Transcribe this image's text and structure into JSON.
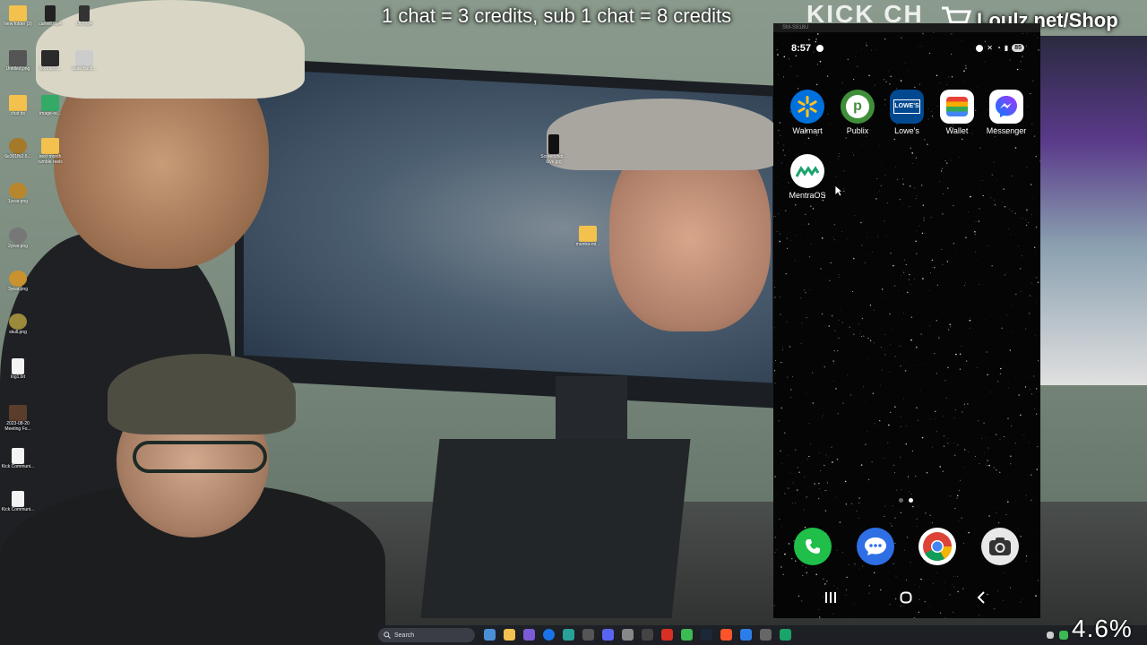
{
  "overlay": {
    "credits_text": "1 chat = 3 credits, sub 1 chat = 8 credits",
    "shop_text": "Loulz.net/Shop",
    "shop_bg_text": "KICK CH",
    "zoom_readout": "4.6%"
  },
  "desktop_icons": [
    {
      "label": "New folder (2)",
      "icon": "folder-icon"
    },
    {
      "label": "camell.mp4",
      "icon": "video-file-icon"
    },
    {
      "label": "cfb.mp4",
      "icon": "video-file-icon"
    },
    {
      "label": "Untitled.png",
      "icon": "image-file-icon"
    },
    {
      "label": "liketrains...",
      "icon": "image-file-icon"
    },
    {
      "label": "waterbuck...",
      "icon": "image-file-icon"
    },
    {
      "label": "chat tts",
      "icon": "folder-icon"
    },
    {
      "label": "image-re...",
      "icon": "image-file-icon"
    },
    {
      "label": "6e301fb2-5...",
      "icon": "image-file-icon"
    },
    {
      "label": "next month rumble reels",
      "icon": "folder-icon"
    },
    {
      "label": "1year.png",
      "icon": "badge-icon"
    },
    {
      "label": "2year.png",
      "icon": "badge-icon"
    },
    {
      "label": "3year.png",
      "icon": "badge-icon"
    },
    {
      "label": "skull.png",
      "icon": "skull-icon"
    },
    {
      "label": "log1.txt",
      "icon": "text-file-icon"
    },
    {
      "label": "2023-08-20 Meeting Fo...",
      "icon": "image-file-icon"
    },
    {
      "label": "Kick Communi...",
      "icon": "text-file-icon"
    },
    {
      "label": "Kick Communi...",
      "icon": "text-file-icon"
    }
  ],
  "monitor_files": [
    {
      "label": "Screenshot... Live.jpg",
      "icon": "image-file-icon"
    },
    {
      "label": "mentra-mi...",
      "icon": "folder-icon"
    }
  ],
  "phone": {
    "window_title": "SM-S918U",
    "status_time": "8:57",
    "battery": "85",
    "apps": [
      {
        "name": "Walmart",
        "icon": "walmart-icon",
        "color": "#0071dc"
      },
      {
        "name": "Publix",
        "icon": "publix-icon",
        "color": "#3f8f3a"
      },
      {
        "name": "Lowe's",
        "icon": "lowes-icon",
        "color": "#004990"
      },
      {
        "name": "Wallet",
        "icon": "wallet-icon",
        "color": "#ffffff"
      },
      {
        "name": "Messenger",
        "icon": "messenger-icon",
        "color": "#ffffff"
      },
      {
        "name": "MentraOS",
        "icon": "mentraos-icon",
        "color": "#ffffff"
      }
    ],
    "dock": [
      {
        "name": "Phone",
        "icon": "phone-icon",
        "color": "#1fbf4a"
      },
      {
        "name": "Messages",
        "icon": "messages-icon",
        "color": "#2f6fe6"
      },
      {
        "name": "Chrome",
        "icon": "chrome-icon",
        "color": "#ffffff"
      },
      {
        "name": "Camera",
        "icon": "camera-icon",
        "color": "#e8e8e8"
      }
    ]
  },
  "taskbar": {
    "search_label": "Search"
  }
}
